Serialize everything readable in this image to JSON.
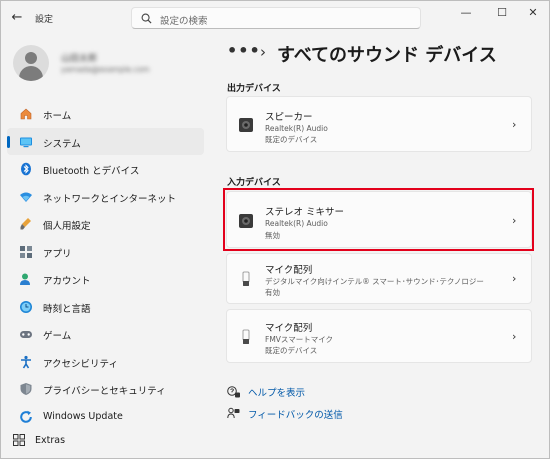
{
  "window": {
    "title": "設定",
    "controls": {
      "minimize": "—",
      "maximize": "☐",
      "close": "✕"
    }
  },
  "search": {
    "placeholder": "設定の検索"
  },
  "profile": {
    "name": "山田太郎",
    "email": "yamada@example.com"
  },
  "nav": {
    "items": [
      {
        "label": "ホーム",
        "icon": "home-icon"
      },
      {
        "label": "システム",
        "icon": "system-icon",
        "active": true
      },
      {
        "label": "Bluetooth とデバイス",
        "icon": "bluetooth-icon"
      },
      {
        "label": "ネットワークとインターネット",
        "icon": "network-icon"
      },
      {
        "label": "個人用設定",
        "icon": "personalization-icon"
      },
      {
        "label": "アプリ",
        "icon": "apps-icon"
      },
      {
        "label": "アカウント",
        "icon": "accounts-icon"
      },
      {
        "label": "時刻と言語",
        "icon": "time-language-icon"
      },
      {
        "label": "ゲーム",
        "icon": "gaming-icon"
      },
      {
        "label": "アクセシビリティ",
        "icon": "accessibility-icon"
      },
      {
        "label": "プライバシーとセキュリティ",
        "icon": "privacy-shield-icon"
      },
      {
        "label": "Windows Update",
        "icon": "windows-update-icon"
      }
    ],
    "extras": "Extras"
  },
  "breadcrumb": {
    "more": "•••",
    "separator": "›",
    "title": "すべてのサウンド デバイス"
  },
  "output_section": {
    "heading": "出力デバイス",
    "devices": [
      {
        "name": "スピーカー",
        "driver": "Realtek(R) Audio",
        "status": "既定のデバイス",
        "icon": "speaker-icon"
      }
    ]
  },
  "input_section": {
    "heading": "入力デバイス",
    "devices": [
      {
        "name": "ステレオ ミキサー",
        "driver": "Realtek(R) Audio",
        "status": "無効",
        "icon": "stereo-mixer-icon"
      },
      {
        "name": "マイク配列",
        "driver": "デジタルマイク向けインテル® スマート･サウンド･テクノロジー",
        "status": "有効",
        "icon": "microphone-icon"
      },
      {
        "name": "マイク配列",
        "driver": "FMVスマートマイク",
        "status": "既定のデバイス",
        "icon": "microphone-icon"
      }
    ]
  },
  "links": {
    "help": "ヘルプを表示",
    "feedback": "フィードバックの送信"
  },
  "colors": {
    "accent": "#0067c0",
    "highlight": "#e3001b",
    "link": "#0058a8"
  }
}
